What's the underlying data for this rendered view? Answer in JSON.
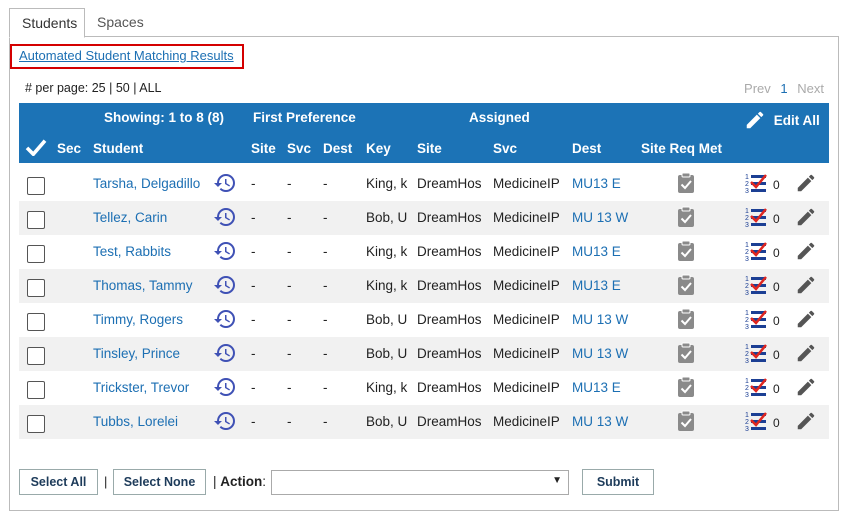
{
  "tabs": [
    {
      "label": "Students",
      "active": true
    },
    {
      "label": "Spaces",
      "active": false
    }
  ],
  "link": {
    "label": "Automated Student Matching Results"
  },
  "per_page": {
    "label": "# per page:",
    "options": [
      "25",
      "50",
      "ALL"
    ]
  },
  "pager": {
    "prev": "Prev",
    "current": "1",
    "next": "Next"
  },
  "header": {
    "showing": "Showing: 1 to 8 (8)",
    "first_preference": "First Preference",
    "assigned": "Assigned",
    "edit_all": "Edit All",
    "columns": {
      "sec": "Sec",
      "student": "Student",
      "site": "Site",
      "svc": "Svc",
      "dest": "Dest",
      "key": "Key",
      "a_site": "Site",
      "a_svc": "Svc",
      "a_dest": "Dest",
      "site_req_met": "Site Req Met"
    }
  },
  "rows": [
    {
      "student": "Tarsha, Delgadillo",
      "fp_site": "-",
      "fp_svc": "-",
      "fp_dest": "-",
      "key": "King, k",
      "site": "DreamHos",
      "svc": "MedicineIP",
      "dest": "MU13 E",
      "count": "0"
    },
    {
      "student": "Tellez, Carin",
      "fp_site": "-",
      "fp_svc": "-",
      "fp_dest": "-",
      "key": "Bob, U",
      "site": "DreamHos",
      "svc": "MedicineIP",
      "dest": "MU 13 W",
      "count": "0"
    },
    {
      "student": "Test, Rabbits",
      "fp_site": "-",
      "fp_svc": "-",
      "fp_dest": "-",
      "key": "King, k",
      "site": "DreamHos",
      "svc": "MedicineIP",
      "dest": "MU13 E",
      "count": "0"
    },
    {
      "student": "Thomas, Tammy",
      "fp_site": "-",
      "fp_svc": "-",
      "fp_dest": "-",
      "key": "King, k",
      "site": "DreamHos",
      "svc": "MedicineIP",
      "dest": "MU13 E",
      "count": "0"
    },
    {
      "student": "Timmy, Rogers",
      "fp_site": "-",
      "fp_svc": "-",
      "fp_dest": "-",
      "key": "Bob, U",
      "site": "DreamHos",
      "svc": "MedicineIP",
      "dest": "MU 13 W",
      "count": "0"
    },
    {
      "student": "Tinsley, Prince",
      "fp_site": "-",
      "fp_svc": "-",
      "fp_dest": "-",
      "key": "Bob, U",
      "site": "DreamHos",
      "svc": "MedicineIP",
      "dest": "MU 13 W",
      "count": "0"
    },
    {
      "student": "Trickster, Trevor",
      "fp_site": "-",
      "fp_svc": "-",
      "fp_dest": "-",
      "key": "King, k",
      "site": "DreamHos",
      "svc": "MedicineIP",
      "dest": "MU13 E",
      "count": "0"
    },
    {
      "student": "Tubbs, Lorelei",
      "fp_site": "-",
      "fp_svc": "-",
      "fp_dest": "-",
      "key": "Bob, U",
      "site": "DreamHos",
      "svc": "MedicineIP",
      "dest": "MU 13 W",
      "count": "0"
    }
  ],
  "footer": {
    "select_all": "Select All",
    "select_none": "Select None",
    "separator": "|",
    "action_label": "Action",
    "action_colon": ":",
    "action_value": "",
    "submit": "Submit"
  },
  "colors": {
    "header_bg": "#1c73b6",
    "link": "#1c6fb3",
    "history_icon": "#3f51b5",
    "highlight_border": "#d40000"
  },
  "icons": {
    "check_all": "checkmark-icon",
    "edit_all": "pencil-icon",
    "history": "history-icon",
    "site_req": "clipboard-check-icon",
    "rank": "ranking-list-icon",
    "edit": "pencil-icon"
  }
}
